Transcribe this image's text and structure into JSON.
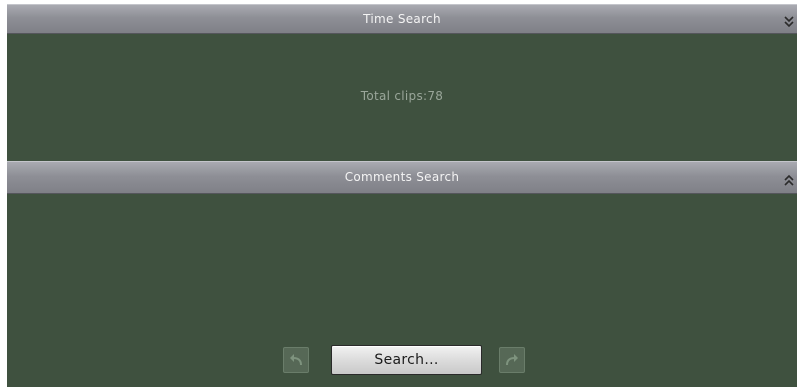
{
  "time_search": {
    "title": "Time Search",
    "collapse_icon": "double-chevron-down-icon",
    "total_clips_text": "Total clips:78"
  },
  "comments_search": {
    "title": "Comments Search",
    "collapse_icon": "double-chevron-up-icon"
  },
  "toolbar": {
    "undo_icon": "undo-arrow-icon",
    "search_label": "Search...",
    "redo_icon": "redo-arrow-icon"
  },
  "colors": {
    "panel_background": "#3f513f",
    "header_gradient_top": "#a9aab1",
    "header_gradient_bottom": "#7f8087",
    "header_text": "#f4f4f4",
    "muted_text": "#9aa69a"
  }
}
